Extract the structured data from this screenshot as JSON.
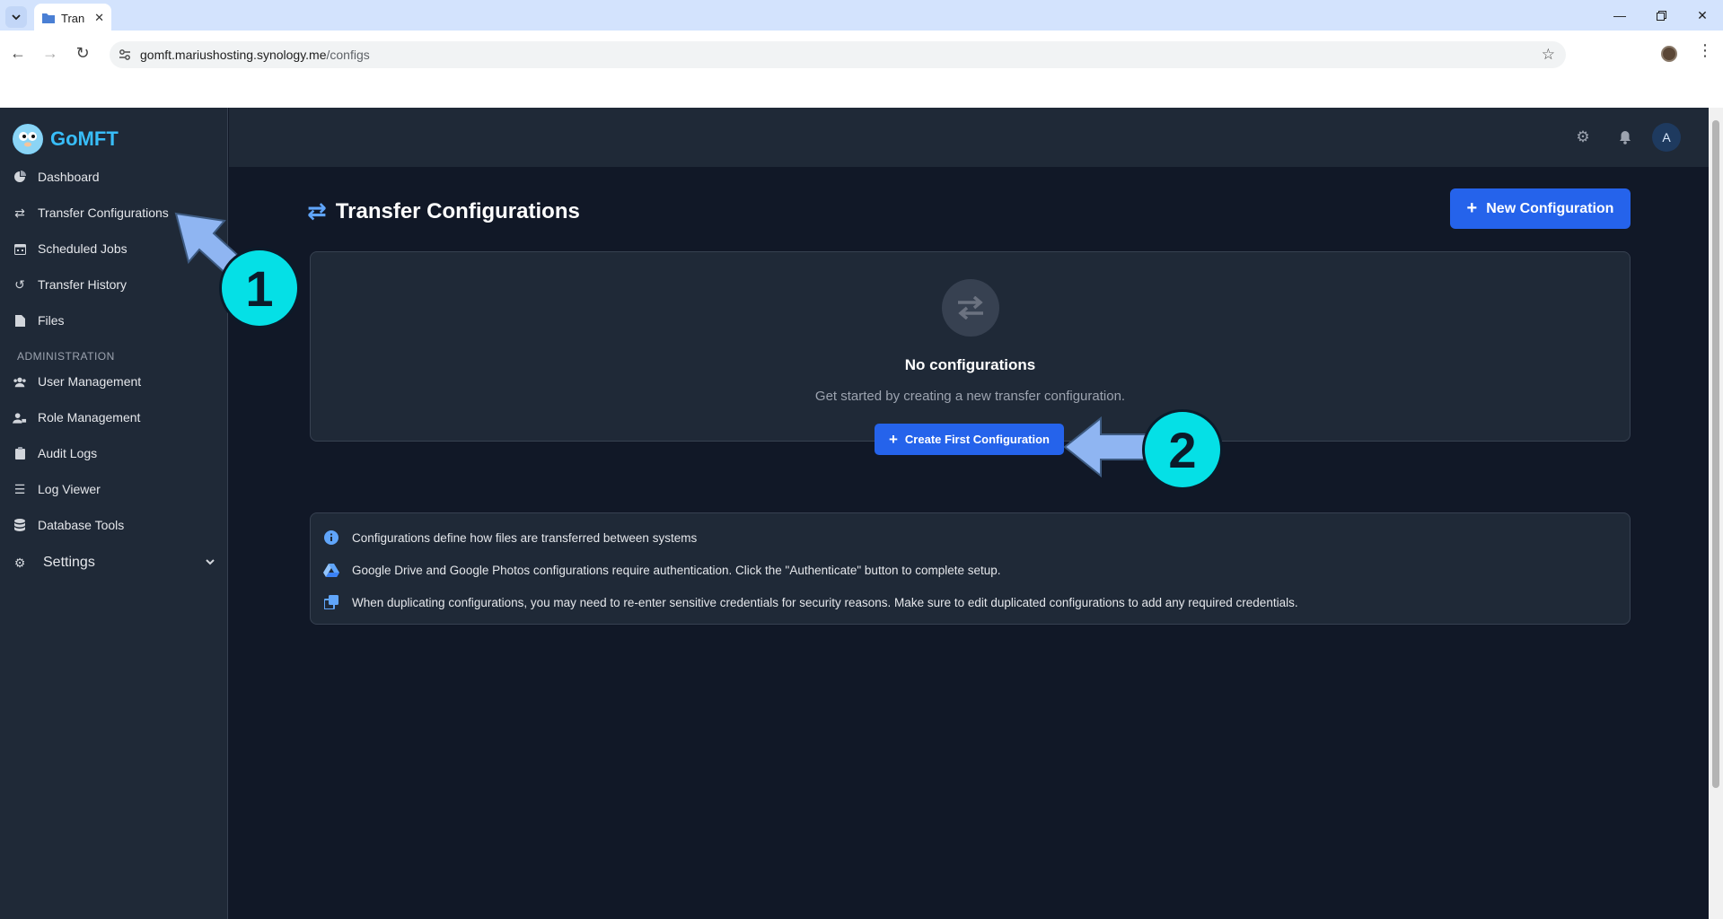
{
  "browser": {
    "tab_title": "Tran",
    "url_host": "gomft.mariushosting.synology.me",
    "url_path": "/configs"
  },
  "app": {
    "brand": "GoMFT",
    "sidebar": {
      "items": [
        {
          "label": "Dashboard",
          "icon": "chart-pie-icon"
        },
        {
          "label": "Transfer Configurations",
          "icon": "exchange-icon"
        },
        {
          "label": "Scheduled Jobs",
          "icon": "calendar-icon"
        },
        {
          "label": "Transfer History",
          "icon": "history-icon"
        },
        {
          "label": "Files",
          "icon": "file-icon"
        }
      ],
      "section_label": "ADMINISTRATION",
      "admin_items": [
        {
          "label": "User Management",
          "icon": "users-icon"
        },
        {
          "label": "Role Management",
          "icon": "user-lock-icon"
        },
        {
          "label": "Audit Logs",
          "icon": "clipboard-icon"
        },
        {
          "label": "Log Viewer",
          "icon": "list-icon"
        },
        {
          "label": "Database Tools",
          "icon": "database-icon"
        }
      ],
      "settings_label": "Settings"
    },
    "topbar": {
      "avatar_initial": "A"
    },
    "page": {
      "title": "Transfer Configurations",
      "new_button": "New Configuration",
      "empty_title": "No configurations",
      "empty_subtitle": "Get started by creating a new transfer configuration.",
      "create_button": "Create First Configuration",
      "info": [
        "Configurations define how files are transferred between systems",
        "Google Drive and Google Photos configurations require authentication. Click the \"Authenticate\" button to complete setup.",
        "When duplicating configurations, you may need to re-enter sensitive credentials for security reasons. Make sure to edit duplicated configurations to add any required credentials."
      ]
    },
    "colors": {
      "accent": "#2563eb",
      "sidebar_bg": "#1f2937",
      "main_bg": "#111827",
      "annotation": "#05e0e6",
      "arrow": "#8fb5f2"
    }
  },
  "annotations": {
    "step1": "1",
    "step2": "2"
  }
}
